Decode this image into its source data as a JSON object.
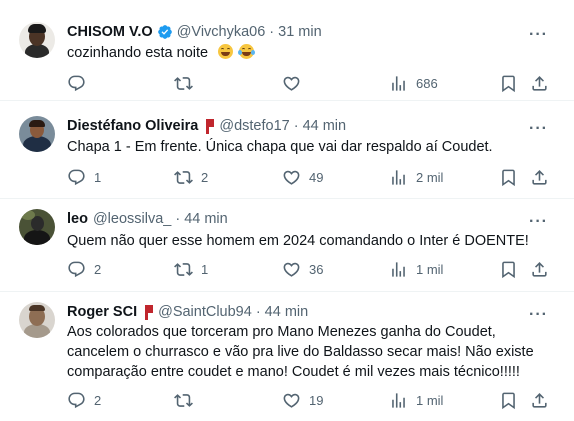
{
  "tweets": [
    {
      "name": "CHISOM V.O",
      "handle": "@Vivchyka06",
      "dot": "·",
      "time": "31 min",
      "text_lines": [
        "cozinhando esta noite"
      ],
      "replies": "",
      "retweets": "",
      "likes": "",
      "views": "686",
      "verified": true,
      "emoji": [
        "grinning-face-emoji",
        "tears-of-joy-emoji"
      ]
    },
    {
      "name": "Diestéfano Oliveira",
      "handle": "@dstefo17",
      "dot": "·",
      "time": "44 min",
      "text_lines": [
        "Chapa 1 - Em frente. Única chapa que vai dar respaldo aí Coudet."
      ],
      "replies": "1",
      "retweets": "2",
      "likes": "49",
      "views": "2 mil"
    },
    {
      "name": "leo",
      "handle": "@leossilva_",
      "dot": "·",
      "time": "44 min",
      "text_lines": [
        "Quem não quer esse homem em 2024 comandando o Inter é DOENTE!"
      ],
      "replies": "2",
      "retweets": "1",
      "likes": "36",
      "views": "1 mil"
    },
    {
      "name": "Roger SCI",
      "handle": "@SaintClub94",
      "dot": "·",
      "time": "44 min",
      "text_lines": [
        "Aos colorados que torceram pro Mano Menezes ganha do Coudet,",
        "cancelem o churrasco e vão pra live do Baldasso secar mais! Não existe",
        "comparação entre coudet e mano! Coudet é mil vezes mais técnico!!!!!"
      ],
      "replies": "2",
      "retweets": "",
      "likes": "19",
      "views": "1 mil"
    }
  ],
  "colors": {
    "text_primary": "#0f1419",
    "text_secondary": "#536471",
    "verified_blue": "#1d9bf0",
    "flag_red": "#c0262d",
    "divider": "#eff3f4"
  }
}
